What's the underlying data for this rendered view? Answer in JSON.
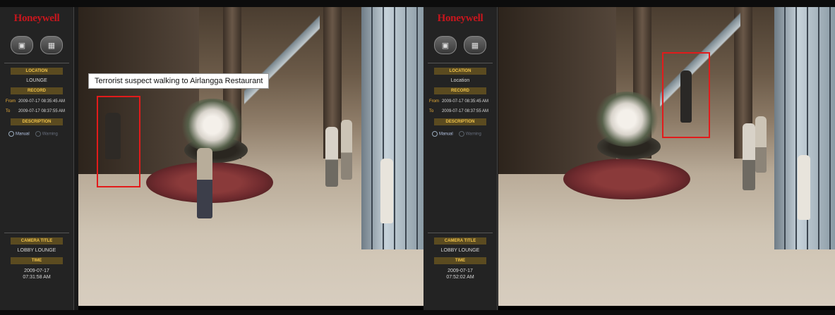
{
  "panels": [
    {
      "brand": "Honeywell",
      "location_header": "LOCATION",
      "location_value": "LOUNGE",
      "second_header": "RECORD",
      "from_label": "From",
      "from_value": "2009-07-17 08:35:45 AM",
      "to_label": "To",
      "to_value": "2009-07-17 08:37:55 AM",
      "description_header": "DESCRIPTION",
      "radio_manual": "Manual",
      "radio_other": "Warning",
      "camera_title_header": "CAMERA TITLE",
      "camera_title_value": "LOBBY LOUNGE",
      "time_header": "TIME",
      "time_value": "2009-07-17 07:31:58 AM",
      "caption": "Terrorist suspect walking to Airlangga Restaurant"
    },
    {
      "brand": "Honeywell",
      "location_header": "LOCATION",
      "location_value": "Location",
      "second_header": "RECORD",
      "from_label": "From",
      "from_value": "2009-07-17 08:35:45 AM",
      "to_label": "To",
      "to_value": "2009-07-17 08:37:55 AM",
      "description_header": "DESCRIPTION",
      "radio_manual": "Manual",
      "radio_other": "Warning",
      "camera_title_header": "CAMERA TITLE",
      "camera_title_value": "LOBBY LOUNGE",
      "time_header": "TIME",
      "time_value": "2009-07-17 07:52:02 AM"
    }
  ],
  "colors": {
    "brand_red": "#c8161d",
    "header_gold": "#f0c34a",
    "alert_box": "#e21b1b"
  },
  "icons": [
    "camera-icon",
    "lock-icon",
    "radio-icon"
  ]
}
